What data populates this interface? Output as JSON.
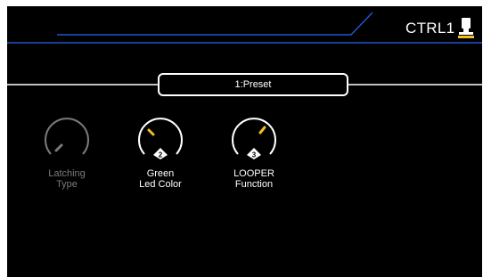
{
  "header": {
    "title": "CTRL1",
    "icon": "footswitch-icon",
    "accent_color": "#2255cc"
  },
  "preset": {
    "label": "1:Preset"
  },
  "knobs": [
    {
      "name_line1": "Latching",
      "name_line2": "Type",
      "badge": "",
      "enabled": false,
      "indicator_color": "#7a7a7a",
      "ring_color": "#7a7a7a"
    },
    {
      "name_line1": "Green",
      "name_line2": "Led Color",
      "badge": "2",
      "enabled": true,
      "indicator_color": "#f0c020",
      "ring_color": "#ffffff"
    },
    {
      "name_line1": "LOOPER",
      "name_line2": "Function",
      "badge": "3",
      "enabled": true,
      "indicator_color": "#f0c020",
      "ring_color": "#ffffff"
    }
  ]
}
